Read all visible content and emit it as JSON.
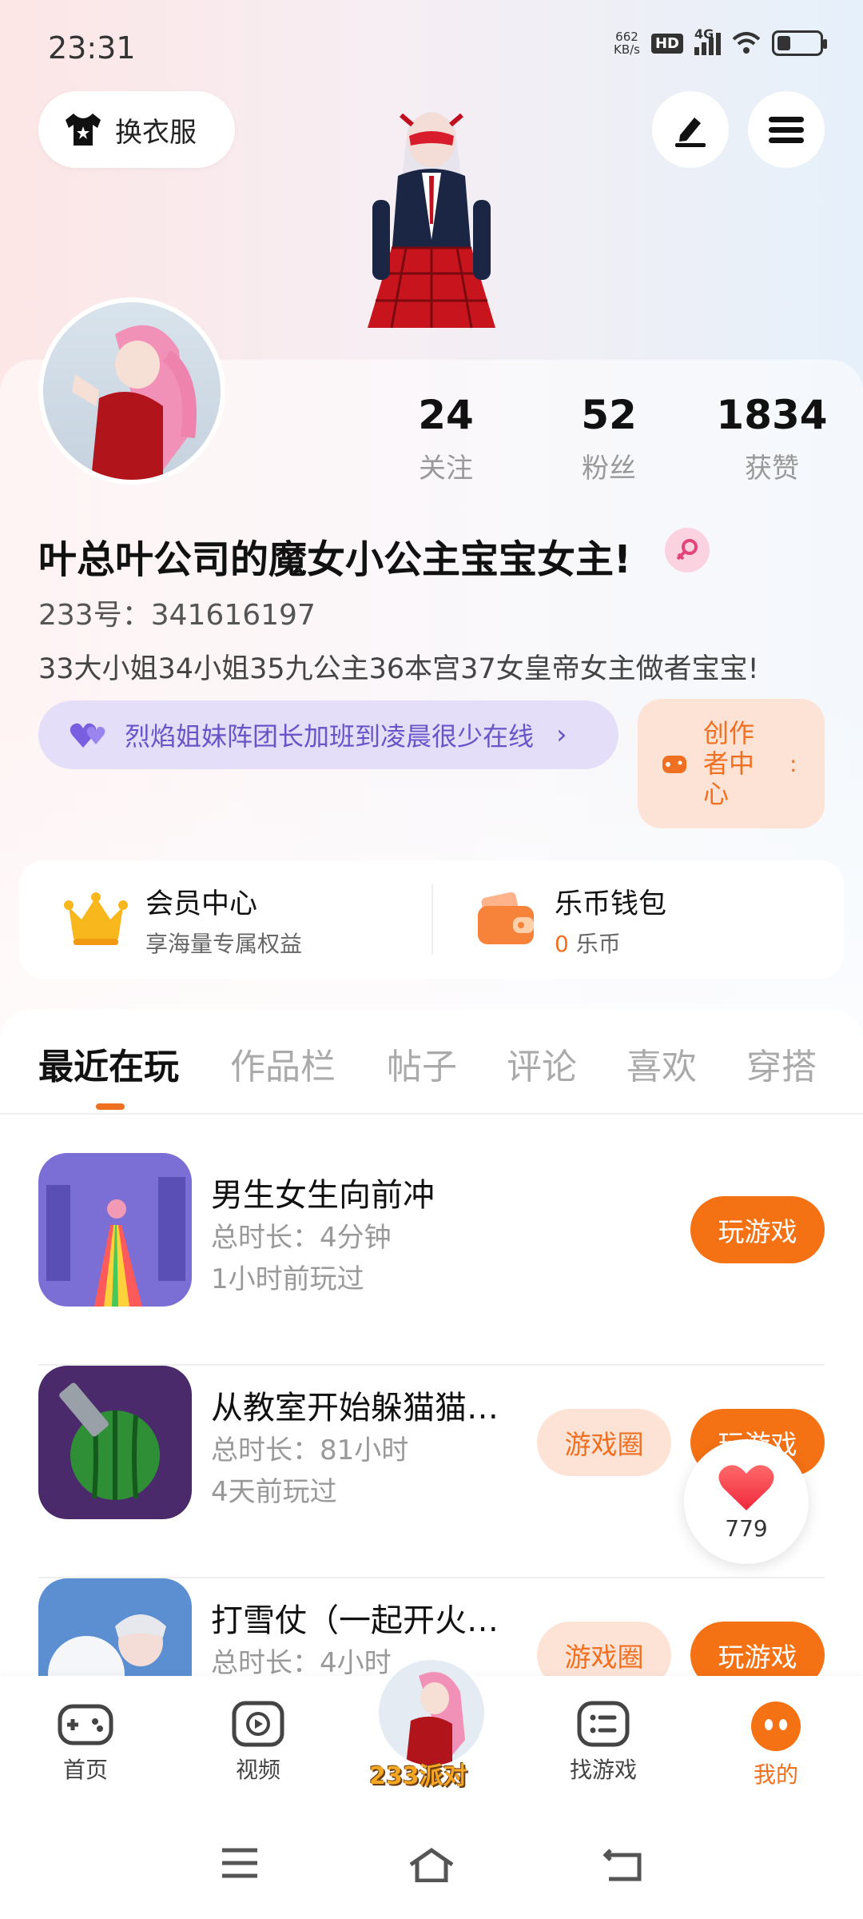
{
  "status_bar": {
    "time": "23:31",
    "net_speed_value": "662",
    "net_speed_unit": "KB/s",
    "hd": "HD",
    "network": "4G"
  },
  "header": {
    "wardrobe_label": "换衣服"
  },
  "stats": [
    {
      "num": "24",
      "label": "关注"
    },
    {
      "num": "52",
      "label": "粉丝"
    },
    {
      "num": "1834",
      "label": "获赞"
    }
  ],
  "profile": {
    "nickname": "叶总叶公司的魔女小公主宝宝女主!",
    "uid": "233号：341616197",
    "bio": "33大小姐34小姐35九公主36本宫37女皇帝女主做者宝宝!",
    "group": "烈焰姐妹阵团长加班到凌晨很少在线",
    "creator": "创作者中心"
  },
  "wallet": {
    "vip_title": "会员中心",
    "vip_sub": "享海量专属权益",
    "coin_title": "乐币钱包",
    "coin_amount": "0",
    "coin_unit": "乐币"
  },
  "tabs": [
    "最近在玩",
    "作品栏",
    "帖子",
    "评论",
    "喜欢",
    "穿搭"
  ],
  "games": [
    {
      "name": "男生女生向前冲",
      "duration": "总时长：4分钟",
      "last": "1小时前玩过",
      "circle": "",
      "play": "玩游戏"
    },
    {
      "name": "从教室开始躲猫猫…",
      "duration": "总时长：81小时",
      "last": "4天前玩过",
      "circle": "游戏圈",
      "play": "玩游戏"
    },
    {
      "name": "打雪仗（一起开火…",
      "duration": "总时长：4小时",
      "last": "",
      "circle": "游戏圈",
      "play": "玩游戏"
    }
  ],
  "like_float": {
    "count": "779"
  },
  "bottom_nav": {
    "home": "首页",
    "video": "视频",
    "center": "233派对",
    "find": "找游戏",
    "mine": "我的"
  },
  "colors": {
    "accent": "#f57214",
    "purple": "#6a54c8"
  }
}
